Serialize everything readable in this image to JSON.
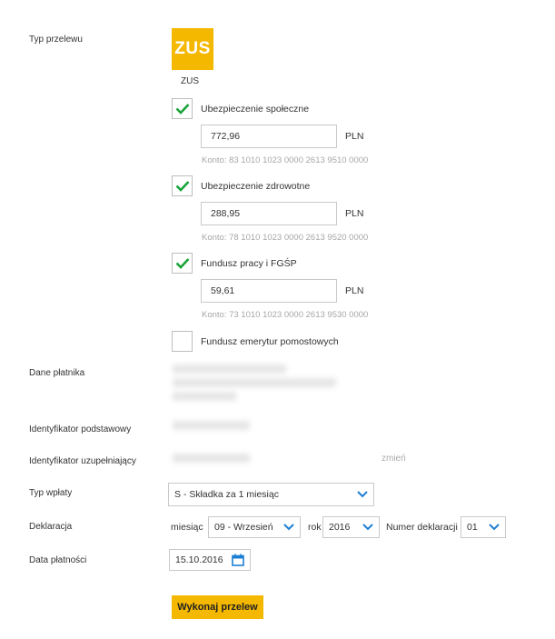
{
  "labels": {
    "typ_przelewu": "Typ przelewu",
    "dane_platnika": "Dane płatnika",
    "identyfikator_podstawowy": "Identyfikator podstawowy",
    "identyfikator_uzupelniajacy": "Identyfikator uzupełniający",
    "typ_wplaty": "Typ wpłaty",
    "deklaracja": "Deklaracja",
    "data_platnosci": "Data płatności"
  },
  "zus": {
    "logo_text": "ZUS",
    "caption": "ZUS"
  },
  "items": [
    {
      "label": "Ubezpieczenie społeczne",
      "checked": true,
      "amount": "772,96",
      "currency": "PLN",
      "konto": "Konto: 83 1010 1023 0000 2613 9510 0000"
    },
    {
      "label": "Ubezpieczenie zdrowotne",
      "checked": true,
      "amount": "288,95",
      "currency": "PLN",
      "konto": "Konto: 78 1010 1023 0000 2613 9520 0000"
    },
    {
      "label": "Fundusz pracy i FGŚP",
      "checked": true,
      "amount": "59,61",
      "currency": "PLN",
      "konto": "Konto: 73 1010 1023 0000 2613 9530 0000"
    },
    {
      "label": "Fundusz emerytur pomostowych",
      "checked": false
    }
  ],
  "zmien": "zmień",
  "typ_wplaty_value": "S - Składka za 1 miesiąc",
  "deklaracja": {
    "miesiac_label": "miesiąc",
    "miesiac_value": "09 - Wrzesień",
    "rok_label": "rok",
    "rok_value": "2016",
    "numer_label": "Numer deklaracji",
    "numer_value": "01"
  },
  "data_platnosci_value": "15.10.2016",
  "submit_label": "Wykonaj przelew",
  "colors": {
    "accent": "#f5b800",
    "check": "#1aa33a",
    "link": "#1d7fd4"
  },
  "icons": {
    "check": "check-icon",
    "chevron": "chevron-down-icon",
    "calendar": "calendar-icon"
  }
}
